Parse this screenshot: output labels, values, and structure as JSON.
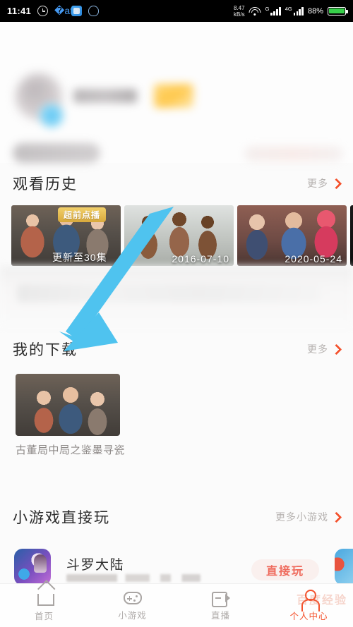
{
  "status_bar": {
    "time": "11:41",
    "icons_left": [
      "alarm-icon",
      "bluetooth-icon",
      "app-icon",
      "ghost-icon"
    ],
    "net_speed_value": "8.47",
    "net_speed_unit": "kB/s",
    "signal_label_1": "G",
    "signal_label_2": "4G",
    "battery_percent": "88%",
    "battery_color": "#37d04a"
  },
  "profile": {
    "redacted": "blurred user profile: avatar, nickname, VIP badge, status bar"
  },
  "sections": {
    "history": {
      "title": "观看历史",
      "more_label": "更多",
      "items": [
        {
          "badge": "超前点播",
          "caption": "更新至30集",
          "caption_pos": "left"
        },
        {
          "badge": "",
          "caption": "2016-07-10",
          "caption_pos": "right"
        },
        {
          "badge": "",
          "caption": "2020-05-24",
          "caption_pos": "right"
        },
        {
          "badge": "",
          "caption": "",
          "caption_pos": "right"
        }
      ]
    },
    "downloads": {
      "title": "我的下载",
      "more_label": "更多",
      "item_title": "古董局中局之鉴墨寻瓷"
    },
    "minigames": {
      "title": "小游戏直接玩",
      "more_label": "更多小游戏",
      "game_name": "斗罗大陆",
      "play_label": "直接玩"
    }
  },
  "bottom_nav": {
    "items": [
      {
        "label": "首页",
        "icon": "home-icon",
        "active": false
      },
      {
        "label": "小游戏",
        "icon": "gamepad-icon",
        "active": false
      },
      {
        "label": "直播",
        "icon": "video-camera-icon",
        "active": false
      },
      {
        "label": "个人中心",
        "icon": "user-icon",
        "active": true
      }
    ]
  },
  "watermark": {
    "text": "百度经验"
  },
  "annotation": {
    "type": "arrow",
    "color": "#4fc3ef",
    "points_to": "我的下载"
  },
  "colors": {
    "accent": "#f4512c",
    "arrow": "#4fc3ef",
    "badge_gold": "#d8a93c",
    "play_button": "#ef6a5c"
  }
}
